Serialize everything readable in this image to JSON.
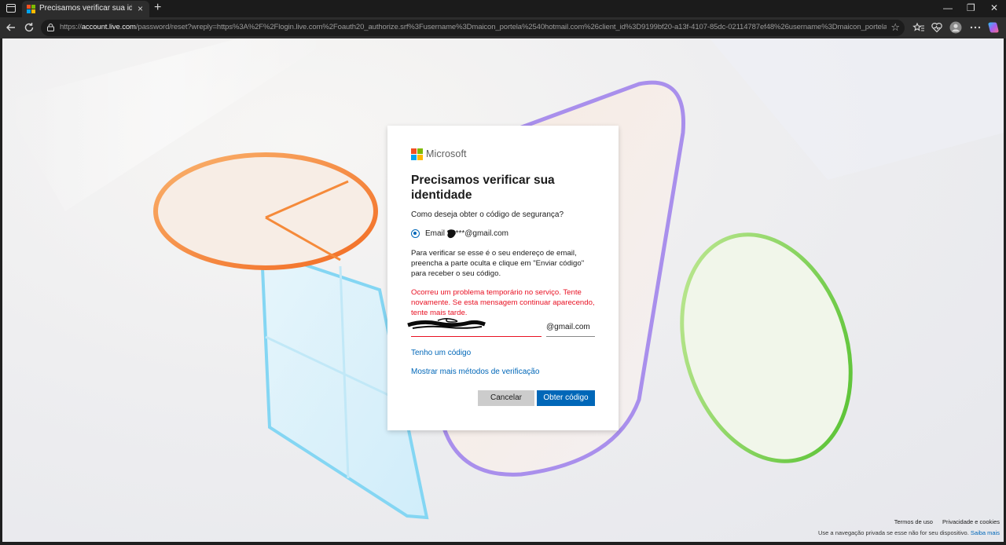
{
  "browser": {
    "tab_title": "Precisamos verificar sua identidade",
    "tab_close": "×",
    "new_tab": "+",
    "url_prefix": "https://",
    "url_host": "account.live.com",
    "url_path": "/password/reset?wreply=https%3A%2F%2Flogin.live.com%2Foauth20_authorize.srf%3Fusername%3Dmaicon_portela%2540hotmail.com%26client_id%3D9199bf20-a13f-4107-85dc-02114787ef48%26username%3Dmaicon_portela...",
    "window_controls": {
      "minimize": "—",
      "restore": "❐",
      "close": "✕"
    }
  },
  "card": {
    "brand": "Microsoft",
    "title": "Precisamos verificar sua identidade",
    "question": "Como deseja obter o código de segurança?",
    "option_label_prefix": "Email ",
    "option_label_suffix": "*****@gmail.com",
    "instructions": "Para verificar se esse é o seu endereço de email, preencha a parte oculta e clique em \"Enviar código\" para receber o seu código.",
    "error": "Ocorreu um problema temporário no serviço. Tente novamente. Se esta mensagem continuar aparecendo, tente mais tarde.",
    "email_value": "",
    "email_domain": "@gmail.com",
    "link_have_code": "Tenho um código",
    "link_more_methods": "Mostrar mais métodos de verificação",
    "cancel_label": "Cancelar",
    "submit_label": "Obter código"
  },
  "footer": {
    "terms": "Termos de uso",
    "privacy": "Privacidade e cookies",
    "private_note": "Use a navegação privada se esse não for seu dispositivo.",
    "learn_more": "Saiba mais"
  },
  "colors": {
    "accent": "#0067b8",
    "error": "#e81123",
    "ms_red": "#f25022",
    "ms_green": "#7fba00",
    "ms_blue": "#00a4ef",
    "ms_yellow": "#ffb900"
  }
}
